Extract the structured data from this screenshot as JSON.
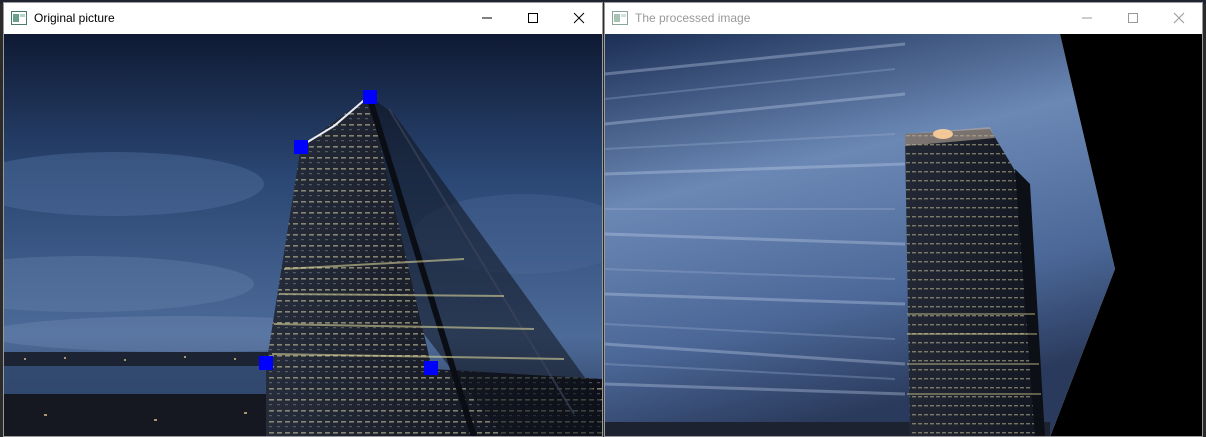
{
  "windows": [
    {
      "title": "Original picture",
      "active": true,
      "icons": [
        "app-icon",
        "minimize-icon",
        "maximize-icon",
        "close-icon"
      ],
      "markers_color": "#0000ff",
      "marker_count": 4
    },
    {
      "title": "The processed image",
      "active": false,
      "icons": [
        "app-icon",
        "minimize-icon",
        "maximize-icon",
        "close-icon"
      ]
    }
  ],
  "colors": {
    "sky_dark": "#0e1a33",
    "sky_mid": "#2c4a7a",
    "sky_light": "#7f9cc4",
    "building": "#1b1f29",
    "window_lights": "#f2e7b0",
    "marker": "#0000ff"
  }
}
